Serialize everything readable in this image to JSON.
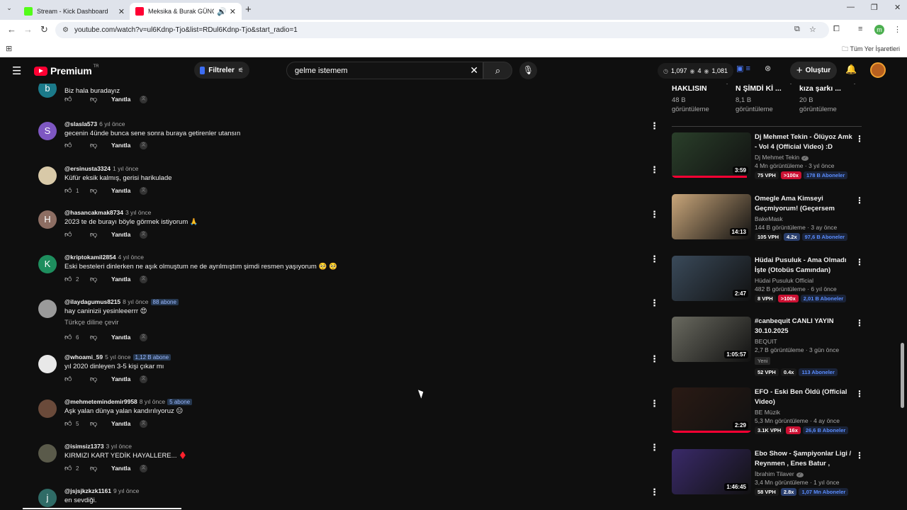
{
  "browser": {
    "tabs": [
      {
        "title": "Stream - Kick Dashboard",
        "color": "#53fc18"
      },
      {
        "title": "Meksika & Burak GÜNCÜ #",
        "color": "#ff0033"
      }
    ],
    "url": "youtube.com/watch?v=ul6Kdnp-Tjo&list=RDul6Kdnp-Tjo&start_radio=1",
    "bookmarks_all": "Tüm Yer İşaretleri",
    "profile_letter": "m"
  },
  "header": {
    "logo": "Premium",
    "country": "TR",
    "filters_label": "Filtreler",
    "search_value": "gelme istemem",
    "stats": [
      "1,097",
      "4",
      "1,081"
    ],
    "create_label": "Oluştur"
  },
  "comments": [
    {
      "avatar_letter": "b",
      "avatar_color": "#1b7a8a",
      "user": "",
      "time": "",
      "sub": "",
      "text": "Biz hala buradayız",
      "likes": "",
      "reply": "Yanıtla",
      "translate": ""
    },
    {
      "avatar_letter": "S",
      "avatar_color": "#7e57c2",
      "user": "@slasla573",
      "time": "6 yıl önce",
      "sub": "",
      "text": "gecenin 4ünde bunca sene sonra buraya getirenler utansın",
      "likes": "",
      "reply": "Yanıtla",
      "translate": ""
    },
    {
      "avatar_letter": "",
      "avatar_color": "#d8c9a8",
      "user": "@ersinusta3324",
      "time": "1 yıl önce",
      "sub": "",
      "text": "Küfür eksik kalmış, gerisi harikulade",
      "likes": "1",
      "reply": "Yanıtla",
      "translate": ""
    },
    {
      "avatar_letter": "H",
      "avatar_color": "#8d6e63",
      "user": "@hasancakmak8734",
      "time": "3 yıl önce",
      "sub": "",
      "text": "2023 te de burayı böyle görmek istiyorum 🙏",
      "likes": "",
      "reply": "Yanıtla",
      "translate": ""
    },
    {
      "avatar_letter": "K",
      "avatar_color": "#1e8e5e",
      "user": "@kriptokamil2854",
      "time": "4 yıl önce",
      "sub": "",
      "text": "Eski besteleri dinlerken ne aşık olmuştum ne de ayrılmıştım  şimdi resmen yaşıyorum 🥺 🥺",
      "likes": "2",
      "reply": "Yanıtla",
      "translate": ""
    },
    {
      "avatar_letter": "",
      "avatar_color": "#9a9a9a",
      "user": "@ilaydagumus8215",
      "time": "8 yıl önce",
      "sub": "88 abone",
      "text": "hay caninizii yesinleeerrr 😍",
      "likes": "6",
      "reply": "Yanıtla",
      "translate": "Türkçe diline çevir"
    },
    {
      "avatar_letter": "",
      "avatar_color": "#e8e8e8",
      "user": "@whoami_59",
      "time": "5 yıl önce",
      "sub": "1,12 B abone",
      "text": "yıl 2020 dinleyen 3-5 kişi çıkar mı",
      "likes": "",
      "reply": "Yanıtla",
      "translate": ""
    },
    {
      "avatar_letter": "",
      "avatar_color": "#6a4a3a",
      "user": "@mehmetemindemir9958",
      "time": "8 yıl önce",
      "sub": "5 abone",
      "text": "Aşk yalan dünya yalan kandırılıyoruz 😑",
      "likes": "5",
      "reply": "Yanıtla",
      "translate": ""
    },
    {
      "avatar_letter": "",
      "avatar_color": "#5a5a4a",
      "user": "@isimsiz1373",
      "time": "3 yıl önce",
      "sub": "",
      "text": "KIRMIZI KART YEDİK HAYALLERE... ♦️",
      "likes": "2",
      "reply": "Yanıtla",
      "translate": ""
    },
    {
      "avatar_letter": "j",
      "avatar_color": "#2f6b66",
      "user": "@jsjsjkzkzk1161",
      "time": "9 yıl önce",
      "sub": "",
      "text": "en sevdiği.",
      "likes": "",
      "reply": "",
      "translate": ""
    }
  ],
  "top_partial": [
    {
      "title": "HAKLISIN",
      "views": "48 B",
      "views_label": "görüntüleme"
    },
    {
      "title": "N ŞİMDİ Kİ ...",
      "views": "8,1 B",
      "views_label": "görüntüleme"
    },
    {
      "title": "kıza şarkı ...",
      "views": "20 B",
      "views_label": "görüntüleme"
    }
  ],
  "videos": [
    {
      "title": "Dj Mehmet Tekin - Ölüyoz Amk - Vol 4 (Official Video) :D",
      "channel": "Dj Mehmet Tekin",
      "verified": true,
      "meta": "4 Mn görüntüleme · 3 yıl önce",
      "duration": "3:59",
      "badge": "",
      "vph": "75 VPH",
      "mult": ">100x",
      "mult_style": "red",
      "subs": "178 B Aboneler",
      "thumb": "#2a3f2a",
      "progress": 0.95
    },
    {
      "title": "Omegle Ama Kimseyi Geçmiyorum! (Geçersem Vide...",
      "channel": "BakeMask",
      "verified": false,
      "meta": "144 B görüntüleme · 3 ay önce",
      "duration": "14:13",
      "badge": "",
      "vph": "105 VPH",
      "mult": "4.2x",
      "mult_style": "blue",
      "subs": "97,6 B Aboneler",
      "thumb": "#c9a67a",
      "progress": 0
    },
    {
      "title": "Hüdai Pusuluk - Ama Olmadı İşte (Otobüs Camından)",
      "channel": "Hüdai Pusuluk Official",
      "verified": false,
      "meta": "482 B görüntüleme · 6 yıl önce",
      "duration": "2:47",
      "badge": "",
      "vph": "8 VPH",
      "mult": ">100x",
      "mult_style": "red",
      "subs": "2,01 B Aboneler",
      "thumb": "#3a4a5a",
      "progress": 0
    },
    {
      "title": "#canbequit CANLI YAYIN 30.10.2025",
      "channel": "BEQUIT",
      "verified": false,
      "meta": "2,7 B görüntüleme · 3 gün önce",
      "duration": "1:05:57",
      "badge": "Yeni",
      "vph": "52 VPH",
      "mult": "0.4x",
      "mult_style": "dark",
      "subs": "113 Aboneler",
      "thumb": "#6a6a60",
      "progress": 0
    },
    {
      "title": "EFO - Eski Ben Öldü (Official Video)",
      "channel": "BE Müzik",
      "verified": false,
      "meta": "5,3 Mn görüntüleme · 4 ay önce",
      "duration": "2:29",
      "badge": "",
      "vph": "3.1K VPH",
      "mult": "16x",
      "mult_style": "red",
      "subs": "26,6 B Aboneler",
      "thumb": "#2a1a14",
      "progress": 1
    },
    {
      "title": "Ebo Show - Şampiyonlar Ligi / Reynmen , Enes Batur , Berkca...",
      "channel": "İbrahim Tilaver",
      "verified": true,
      "meta": "3,4 Mn görüntüleme · 1 yıl önce",
      "duration": "1:46:45",
      "badge": "",
      "vph": "58 VPH",
      "mult": "2.8x",
      "mult_style": "blue",
      "subs": "1,07 Mn Aboneler",
      "thumb": "#3a2a6a",
      "progress": 0
    }
  ]
}
